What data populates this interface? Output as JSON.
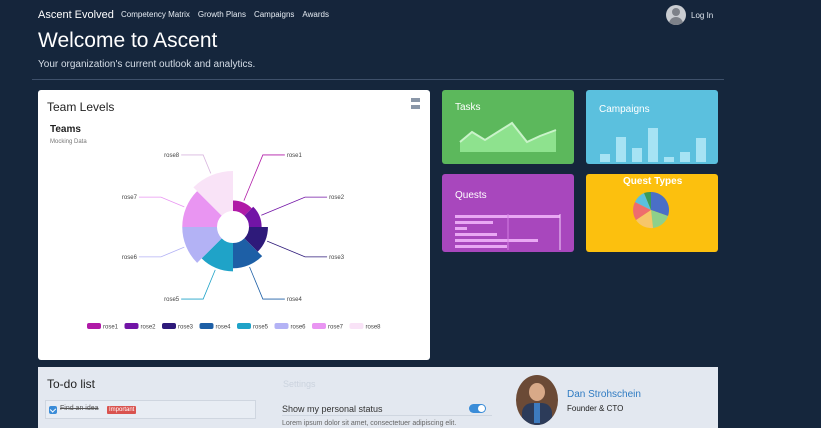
{
  "navbar": {
    "brand": "Ascent Evolved",
    "links": [
      "Competency Matrix",
      "Growth Plans",
      "Campaigns",
      "Awards"
    ],
    "login_label": "Log In"
  },
  "hero": {
    "title": "Welcome to Ascent",
    "subtitle": "Your organization's current outlook and analytics."
  },
  "team_levels": {
    "card_title": "Team Levels",
    "menu_icon": "hamburger-icon",
    "chart_data": {
      "type": "nightingale-rose",
      "title": "Teams",
      "subtitle": "Mocking Data",
      "series": [
        {
          "name": "rose1",
          "value": 10,
          "color": "#b01aa7"
        },
        {
          "name": "rose2",
          "value": 12,
          "color": "#7214a6"
        },
        {
          "name": "rose3",
          "value": 18,
          "color": "#2e1a7a"
        },
        {
          "name": "rose4",
          "value": 24,
          "color": "#1d5fa6"
        },
        {
          "name": "rose5",
          "value": 27,
          "color": "#1fa3c8"
        },
        {
          "name": "rose6",
          "value": 33,
          "color": "#b3b2f5"
        },
        {
          "name": "rose7",
          "value": 33,
          "color": "#e995f2"
        },
        {
          "name": "rose8",
          "value": 38,
          "color": "#f9e3f7"
        }
      ],
      "legend_position": "bottom"
    }
  },
  "tiles": {
    "tasks": "Tasks",
    "campaigns": "Campaigns",
    "quests": "Quests",
    "quest_types": "Quest Types"
  },
  "todo": {
    "title": "To-do list",
    "items": [
      {
        "text": "Find an idea",
        "badge": "Important",
        "done": true
      }
    ]
  },
  "settings": {
    "heading": "Settings",
    "status_label": "Show my personal status",
    "status_enabled": true,
    "status_text": "Lorem ipsum dolor sit amet, consectetuer adipiscing elit."
  },
  "profile": {
    "name": "Dan Strohschein",
    "role": "Founder & CTO"
  }
}
